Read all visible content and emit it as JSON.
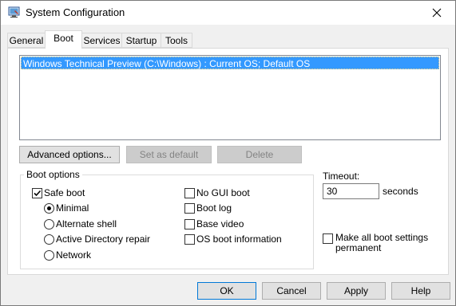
{
  "window": {
    "title": "System Configuration"
  },
  "tabs": [
    {
      "label": "General"
    },
    {
      "label": "Boot"
    },
    {
      "label": "Services"
    },
    {
      "label": "Startup"
    },
    {
      "label": "Tools"
    }
  ],
  "os_list": {
    "items": [
      "Windows Technical Preview (C:\\Windows) : Current OS; Default OS"
    ]
  },
  "os_buttons": {
    "advanced": "Advanced options...",
    "set_default": "Set as default",
    "delete": "Delete"
  },
  "boot_options": {
    "title": "Boot options",
    "safe_boot": {
      "label": "Safe boot",
      "checked": true
    },
    "radios": [
      {
        "label": "Minimal",
        "selected": true
      },
      {
        "label": "Alternate shell",
        "selected": false
      },
      {
        "label": "Active Directory repair",
        "selected": false
      },
      {
        "label": "Network",
        "selected": false
      }
    ],
    "checks": [
      {
        "label": "No GUI boot",
        "checked": false
      },
      {
        "label": "Boot log",
        "checked": false
      },
      {
        "label": "Base video",
        "checked": false
      },
      {
        "label": "OS boot information",
        "checked": false
      }
    ]
  },
  "timeout": {
    "label": "Timeout:",
    "value": "30",
    "unit": "seconds"
  },
  "permanent": {
    "label_line1": "Make all boot settings",
    "label_line2": "permanent",
    "checked": false
  },
  "footer": {
    "ok": "OK",
    "cancel": "Cancel",
    "apply": "Apply",
    "help": "Help"
  }
}
